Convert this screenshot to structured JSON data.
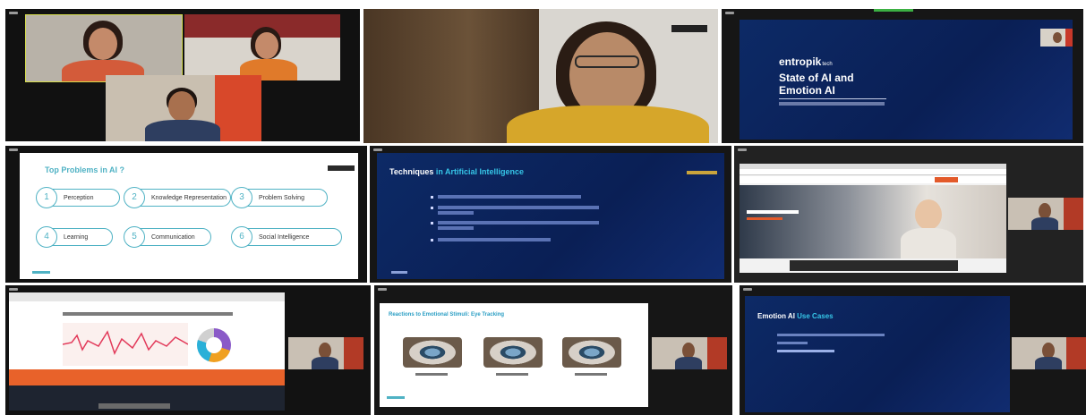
{
  "tiles": {
    "t3": {
      "brand": "entropik",
      "brand_suffix": "tech",
      "title_line1": "State of AI and",
      "title_line2": "Emotion AI"
    },
    "t4": {
      "title": "Top Problems in AI ?",
      "items": [
        {
          "num": "1",
          "label": "Perception"
        },
        {
          "num": "2",
          "label": "Knowledge Representation"
        },
        {
          "num": "3",
          "label": "Problem Solving"
        },
        {
          "num": "4",
          "label": "Learning"
        },
        {
          "num": "5",
          "label": "Communication"
        },
        {
          "num": "6",
          "label": "Social Intelligence"
        }
      ]
    },
    "t5": {
      "title_part1": "Techniques",
      "title_part2": "in Artificial Intelligence"
    },
    "t8": {
      "title": "Reactions to Emotional Stimuli: Eye Tracking"
    },
    "t9": {
      "title_part1": "Emotion AI",
      "title_part2": "Use Cases"
    }
  }
}
